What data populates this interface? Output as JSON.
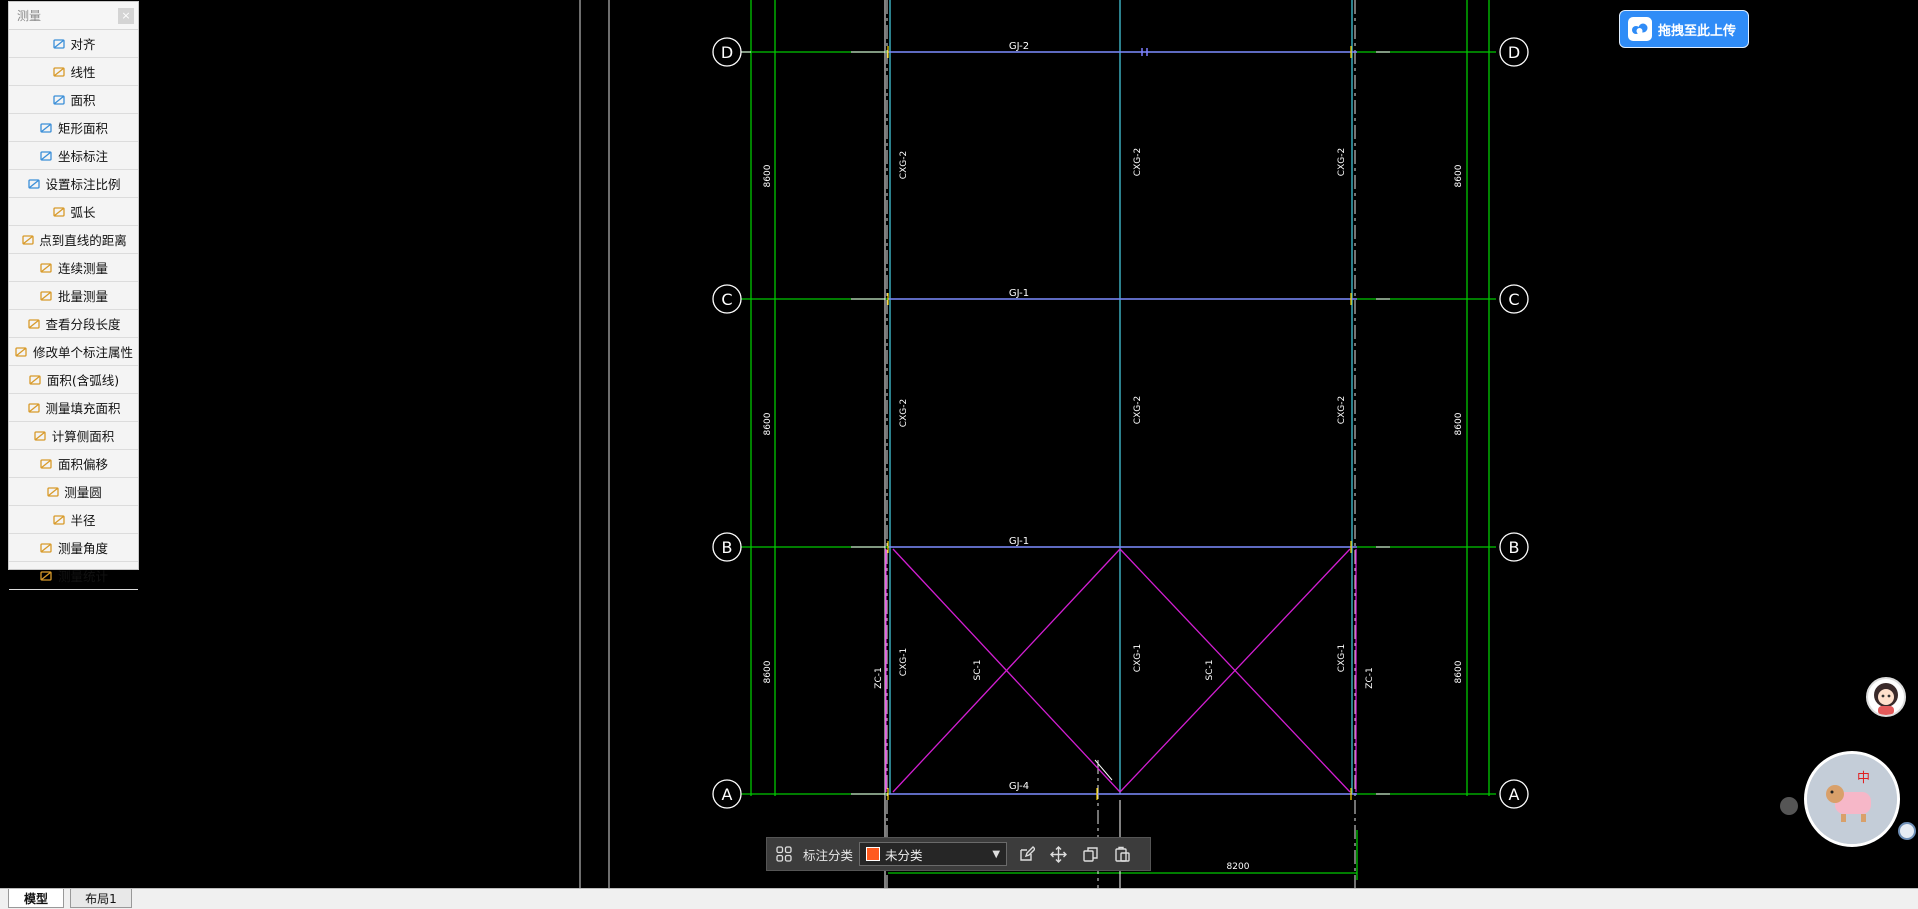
{
  "palette": {
    "title": "测量",
    "close": "×",
    "items": [
      {
        "label": "对齐",
        "icon": "align-icon"
      },
      {
        "label": "线性",
        "icon": "linear-dim-icon"
      },
      {
        "label": "面积",
        "icon": "area-icon"
      },
      {
        "label": "矩形面积",
        "icon": "rect-area-icon"
      },
      {
        "label": "坐标标注",
        "icon": "coordinate-icon"
      },
      {
        "label": "设置标注比例",
        "icon": "scale-icon"
      },
      {
        "label": "弧长",
        "icon": "arc-length-icon"
      },
      {
        "label": "点到直线的距离",
        "icon": "point-line-distance-icon"
      },
      {
        "label": "连续测量",
        "icon": "continuous-measure-icon"
      },
      {
        "label": "批量测量",
        "icon": "batch-measure-icon"
      },
      {
        "label": "查看分段长度",
        "icon": "segment-length-icon"
      },
      {
        "label": "修改单个标注属性",
        "icon": "edit-dimension-icon"
      },
      {
        "label": "面积(含弧线)",
        "icon": "arc-area-icon"
      },
      {
        "label": "测量填充面积",
        "icon": "fill-area-icon"
      },
      {
        "label": "计算侧面积",
        "icon": "side-area-icon"
      },
      {
        "label": "面积偏移",
        "icon": "area-offset-icon"
      },
      {
        "label": "测量圆",
        "icon": "circle-measure-icon"
      },
      {
        "label": "半径",
        "icon": "radius-icon"
      },
      {
        "label": "测量角度",
        "icon": "angle-icon"
      },
      {
        "label": "测量统计",
        "icon": "statistics-icon"
      }
    ]
  },
  "upload": {
    "label": "拖拽至此上传"
  },
  "annotation_bar": {
    "label": "标注分类",
    "category": "未分类",
    "swatch_color": "#ff5a1f"
  },
  "tabs": {
    "model": "模型",
    "layout": "布局1"
  },
  "drawing": {
    "axes": [
      "D",
      "C",
      "B",
      "A"
    ],
    "beam_labels": [
      "GJ-2",
      "GJ-1",
      "GJ-1",
      "GJ-4"
    ],
    "span_labels": [
      "8600",
      "8600",
      "8600"
    ],
    "vertical_labels": {
      "cxg2": "CXG-2",
      "cxg1": "CXG-1",
      "zc1": "ZC-1",
      "sc1": "SC-1"
    },
    "bottom_dim": "8200",
    "colors": {
      "grid": "#00c800",
      "beam": "#7d7dff",
      "column": "#3fb7c8",
      "brace": "#d21ed2",
      "white": "#ffffff"
    }
  }
}
